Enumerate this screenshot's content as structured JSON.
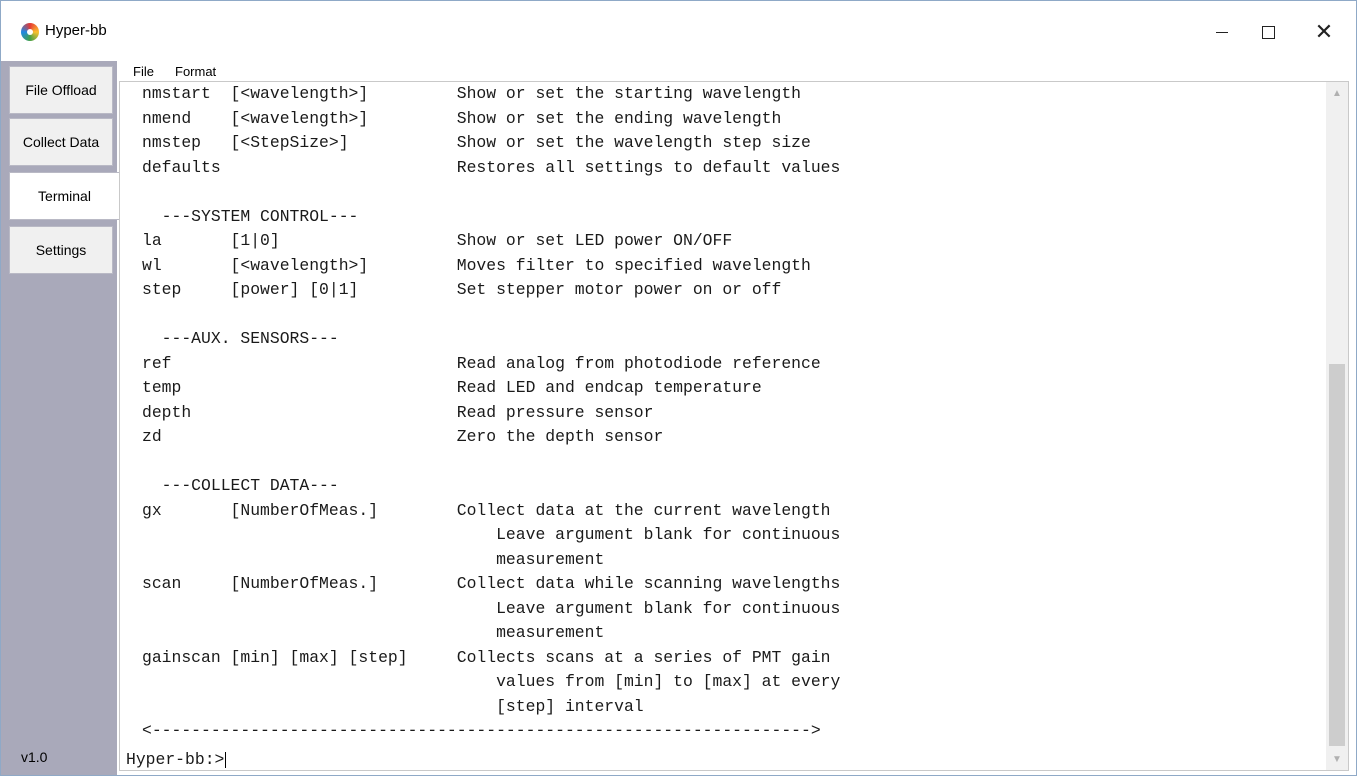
{
  "window": {
    "title": "Hyper-bb",
    "controls": {
      "minimize": "minimize-icon",
      "maximize": "maximize-icon",
      "close": "close-icon"
    }
  },
  "sidebar": {
    "tabs": [
      {
        "label": "File Offload",
        "active": false
      },
      {
        "label": "Collect Data",
        "active": false
      },
      {
        "label": "Terminal",
        "active": true
      },
      {
        "label": "Settings",
        "active": false
      }
    ],
    "version": "v1.0"
  },
  "menu": {
    "file": "File",
    "format": "Format"
  },
  "terminal": {
    "lines": [
      "nmstart  [<wavelength>]         Show or set the starting wavelength",
      "nmend    [<wavelength>]         Show or set the ending wavelength",
      "nmstep   [<StepSize>]           Show or set the wavelength step size",
      "defaults                        Restores all settings to default values",
      "",
      "  ---SYSTEM CONTROL---",
      "la       [1|0]                  Show or set LED power ON/OFF",
      "wl       [<wavelength>]         Moves filter to specified wavelength",
      "step     [power] [0|1]          Set stepper motor power on or off",
      "",
      "  ---AUX. SENSORS---",
      "ref                             Read analog from photodiode reference",
      "temp                            Read LED and endcap temperature",
      "depth                           Read pressure sensor",
      "zd                              Zero the depth sensor",
      "",
      "  ---COLLECT DATA---",
      "gx       [NumberOfMeas.]        Collect data at the current wavelength",
      "                                    Leave argument blank for continuous",
      "                                    measurement",
      "scan     [NumberOfMeas.]        Collect data while scanning wavelengths",
      "                                    Leave argument blank for continuous",
      "                                    measurement",
      "gainscan [min] [max] [step]     Collects scans at a series of PMT gain",
      "                                    values from [min] to [max] at every",
      "                                    [step] interval",
      "<------------------------------------------------------------------->"
    ],
    "prompt": "Hyper-bb:>"
  }
}
